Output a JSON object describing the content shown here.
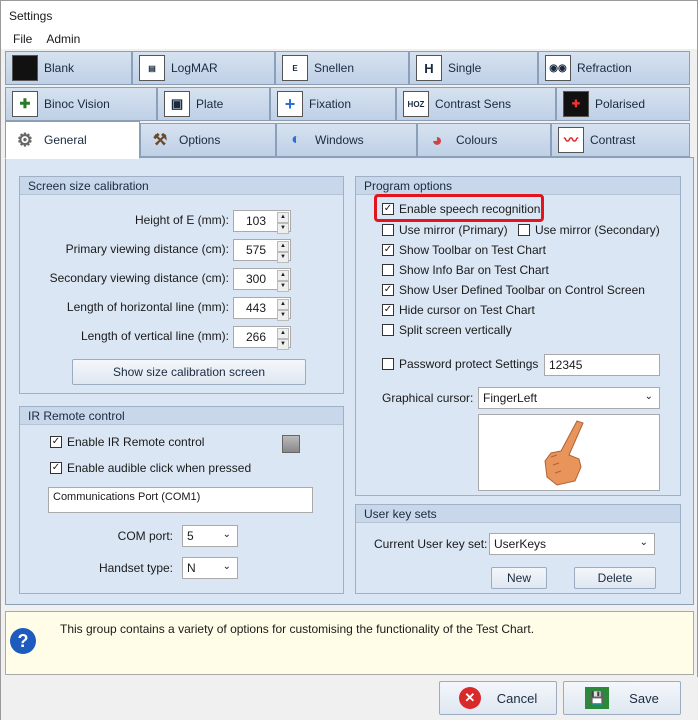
{
  "window": {
    "title": "Settings"
  },
  "menu": {
    "file": "File",
    "admin": "Admin"
  },
  "tabs_row1": [
    {
      "label": "Blank",
      "icon": "blank-icon"
    },
    {
      "label": "LogMAR",
      "icon": "logmar-chart-icon"
    },
    {
      "label": "Snellen",
      "icon": "snellen-chart-icon"
    },
    {
      "label": "Single",
      "icon": "single-letter-icon"
    },
    {
      "label": "Refraction",
      "icon": "refraction-icon"
    }
  ],
  "tabs_row2": [
    {
      "label": "Binoc Vision",
      "icon": "binoc-vision-icon"
    },
    {
      "label": "Plate",
      "icon": "plate-icon"
    },
    {
      "label": "Fixation",
      "icon": "fixation-icon"
    },
    {
      "label": "Contrast Sens",
      "icon": "contrast-sens-icon"
    },
    {
      "label": "Polarised",
      "icon": "polarised-icon"
    }
  ],
  "tabs_row3": [
    {
      "label": "General",
      "icon": "gears-icon"
    },
    {
      "label": "Options",
      "icon": "options-icon"
    },
    {
      "label": "Windows",
      "icon": "windows-icon"
    },
    {
      "label": "Colours",
      "icon": "colours-icon"
    },
    {
      "label": "Contrast",
      "icon": "contrast-icon"
    }
  ],
  "screen_calibration": {
    "title": "Screen size calibration",
    "fields": [
      {
        "label": "Height of E (mm):",
        "value": "103"
      },
      {
        "label": "Primary viewing distance (cm):",
        "value": "575"
      },
      {
        "label": "Secondary viewing distance (cm):",
        "value": "300"
      },
      {
        "label": "Length of horizontal line (mm):",
        "value": "443"
      },
      {
        "label": "Length of vertical line (mm):",
        "value": "266"
      }
    ],
    "show_button": "Show size calibration screen"
  },
  "ir_remote": {
    "title": "IR Remote control",
    "enable_ir": "Enable IR Remote control",
    "enable_click": "Enable audible click when pressed",
    "comm_port_text": "Communications Port (COM1)",
    "com_port_label": "COM port:",
    "com_port_value": "5",
    "handset_label": "Handset type:",
    "handset_value": "N"
  },
  "program_options": {
    "title": "Program options",
    "speech": "Enable speech recognition",
    "mirror_primary": "Use mirror (Primary)",
    "mirror_secondary": "Use mirror (Secondary)",
    "show_toolbar": "Show Toolbar on Test Chart",
    "show_infobar": "Show Info Bar on Test Chart",
    "show_user_toolbar": "Show User Defined Toolbar on Control Screen",
    "hide_cursor": "Hide cursor on Test Chart",
    "split_screen": "Split screen vertically",
    "password_protect": "Password protect Settings",
    "password_value": "12345",
    "graphical_cursor_label": "Graphical cursor:",
    "graphical_cursor_value": "FingerLeft"
  },
  "user_keys": {
    "title": "User key sets",
    "current_label": "Current User key set:",
    "current_value": "UserKeys",
    "new_button": "New",
    "delete_button": "Delete"
  },
  "info": {
    "text": "This group contains a variety of options for customising the functionality of the Test Chart."
  },
  "footer": {
    "cancel": "Cancel",
    "save": "Save"
  },
  "colors": {
    "highlight": "#e3141b",
    "panel": "#dbe6f4",
    "info_bg": "#fffde8"
  }
}
